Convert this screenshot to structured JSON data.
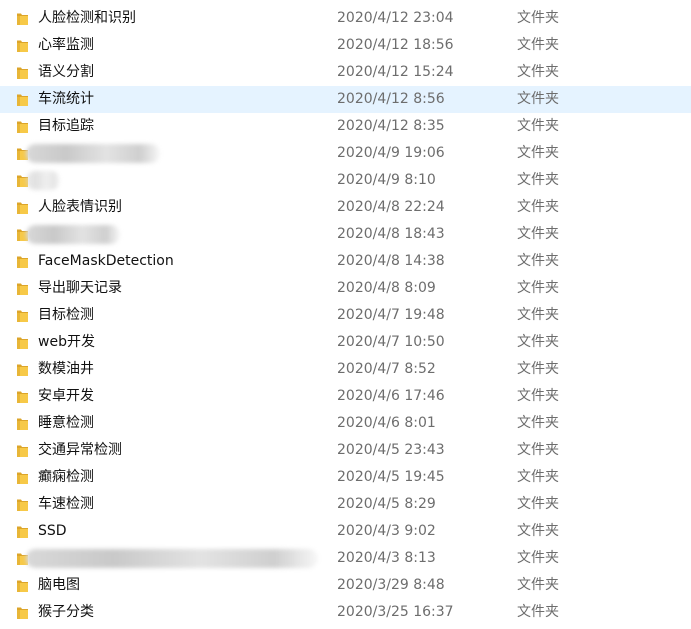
{
  "files": [
    {
      "name": "人脸检测和识别",
      "date": "2020/4/12 23:04",
      "type": "文件夹"
    },
    {
      "name": "心率监测",
      "date": "2020/4/12 18:56",
      "type": "文件夹"
    },
    {
      "name": "语义分割",
      "date": "2020/4/12 15:24",
      "type": "文件夹"
    },
    {
      "name": "车流统计",
      "date": "2020/4/12 8:56",
      "type": "文件夹",
      "selected": true
    },
    {
      "name": "目标追踪",
      "date": "2020/4/12 8:35",
      "type": "文件夹"
    },
    {
      "name": "",
      "date": "2020/4/9 19:06",
      "type": "文件夹",
      "redacted": true
    },
    {
      "name": "",
      "date": "2020/4/9 8:10",
      "type": "文件夹",
      "redacted": true
    },
    {
      "name": "人脸表情识别",
      "date": "2020/4/8 22:24",
      "type": "文件夹"
    },
    {
      "name": "",
      "date": "2020/4/8 18:43",
      "type": "文件夹",
      "redacted": true
    },
    {
      "name": "FaceMaskDetection",
      "date": "2020/4/8 14:38",
      "type": "文件夹"
    },
    {
      "name": "导出聊天记录",
      "date": "2020/4/8 8:09",
      "type": "文件夹"
    },
    {
      "name": "目标检测",
      "date": "2020/4/7 19:48",
      "type": "文件夹"
    },
    {
      "name": "web开发",
      "date": "2020/4/7 10:50",
      "type": "文件夹"
    },
    {
      "name": "数模油井",
      "date": "2020/4/7 8:52",
      "type": "文件夹"
    },
    {
      "name": "安卓开发",
      "date": "2020/4/6 17:46",
      "type": "文件夹"
    },
    {
      "name": "睡意检测",
      "date": "2020/4/6 8:01",
      "type": "文件夹"
    },
    {
      "name": "交通异常检测",
      "date": "2020/4/5 23:43",
      "type": "文件夹"
    },
    {
      "name": "癫痫检测",
      "date": "2020/4/5 19:45",
      "type": "文件夹"
    },
    {
      "name": "车速检测",
      "date": "2020/4/5 8:29",
      "type": "文件夹"
    },
    {
      "name": "SSD",
      "date": "2020/4/3 9:02",
      "type": "文件夹"
    },
    {
      "name": "",
      "date": "2020/4/3 8:13",
      "type": "文件夹",
      "redacted": true
    },
    {
      "name": "脑电图",
      "date": "2020/3/29 8:48",
      "type": "文件夹"
    },
    {
      "name": "猴子分类",
      "date": "2020/3/25 16:37",
      "type": "文件夹"
    }
  ],
  "icon": "folder-icon",
  "colors": {
    "folder_body": "#f7c948",
    "folder_edge": "#dca52a",
    "selected_row": "#e5f3ff",
    "secondary_text": "#6d6d6d"
  }
}
